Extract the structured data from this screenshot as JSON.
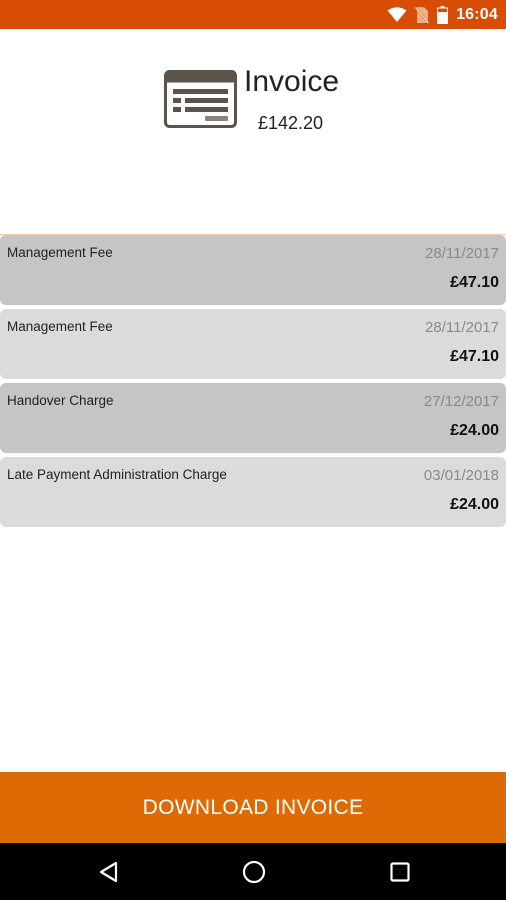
{
  "status_bar": {
    "time": "16:04",
    "icons": [
      "wifi-icon",
      "no-sim-icon",
      "battery-icon"
    ],
    "background": "#d84d06"
  },
  "invoice": {
    "icon": "invoice-icon",
    "title": "Invoice",
    "total": "£142.20"
  },
  "items": [
    {
      "description": "Management Fee",
      "date": "28/11/2017",
      "amount": "£47.10"
    },
    {
      "description": "Management Fee",
      "date": "28/11/2017",
      "amount": "£47.10"
    },
    {
      "description": "Handover Charge",
      "date": "27/12/2017",
      "amount": "£24.00"
    },
    {
      "description": "Late Payment Administration Charge",
      "date": "03/01/2018",
      "amount": "£24.00"
    }
  ],
  "actions": {
    "download_label": "DOWNLOAD INVOICE",
    "button_color": "#dd6a04"
  },
  "nav_bar": {
    "icons": [
      "back-icon",
      "home-icon",
      "recents-icon"
    ]
  }
}
